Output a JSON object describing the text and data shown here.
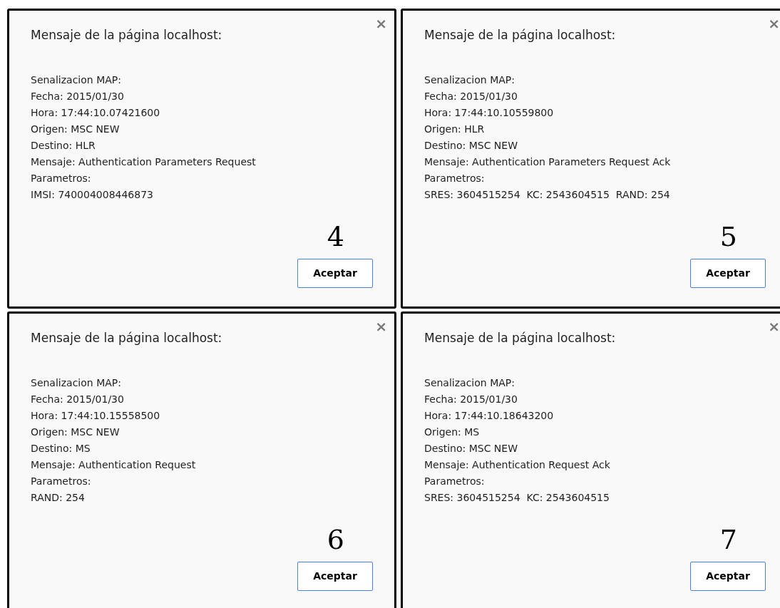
{
  "dialogs": [
    {
      "title": "Mensaje de la página localhost:",
      "close": "×",
      "lines": [
        "Senalizacion MAP:",
        "Fecha: 2015/01/30",
        "Hora: 17:44:10.07421600",
        "Origen: MSC NEW",
        "Destino: HLR",
        "Mensaje: Authentication Parameters Request",
        "Parametros:",
        "IMSI: 740004008446873"
      ],
      "step": "4",
      "button": "Aceptar"
    },
    {
      "title": "Mensaje de la página localhost:",
      "close": "×",
      "lines": [
        "Senalizacion MAP:",
        "Fecha: 2015/01/30",
        "Hora: 17:44:10.10559800",
        "Origen: HLR",
        "Destino: MSC NEW",
        "Mensaje: Authentication Parameters Request Ack",
        "Parametros:",
        "SRES: 3604515254  KC: 2543604515  RAND: 254"
      ],
      "step": "5",
      "button": "Aceptar"
    },
    {
      "title": "Mensaje de la página localhost:",
      "close": "×",
      "lines": [
        "Senalizacion MAP:",
        "Fecha: 2015/01/30",
        "Hora: 17:44:10.15558500",
        "Origen: MSC NEW",
        "Destino: MS",
        "Mensaje: Authentication Request",
        "Parametros:",
        "RAND: 254"
      ],
      "step": "6",
      "button": "Aceptar"
    },
    {
      "title": "Mensaje de la página localhost:",
      "close": "×",
      "lines": [
        "Senalizacion MAP:",
        "Fecha: 2015/01/30",
        "Hora: 17:44:10.18643200",
        "Origen: MS",
        "Destino: MSC NEW",
        "Mensaje: Authentication Request Ack",
        "Parametros:",
        "SRES: 3604515254  KC: 2543604515"
      ],
      "step": "7",
      "button": "Aceptar"
    }
  ]
}
